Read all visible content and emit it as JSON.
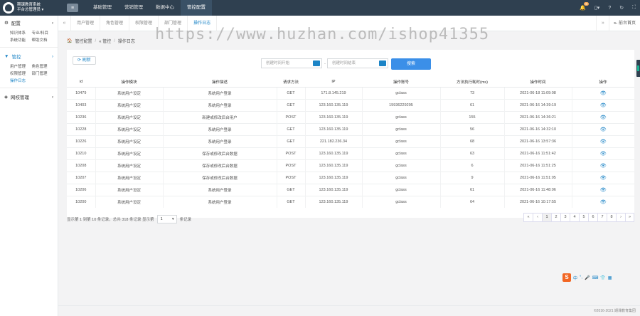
{
  "app": {
    "name_line1": "期课教育系统",
    "name_line2": "平台总管理员 ▾"
  },
  "topnav": [
    "基础管理",
    "营销管理",
    "数据中心",
    "管控配置"
  ],
  "topnav_active": 3,
  "notifications_count": "8",
  "sidebar": {
    "section1": {
      "label": "配置",
      "items": [
        "知识体系",
        "专业/科目",
        "系统功能",
        "帮助文档"
      ]
    },
    "section2": {
      "label": "管控",
      "items": [
        "用户管理",
        "角色管理",
        "权限管理",
        "部门管理",
        "操作日志"
      ],
      "active": 4
    },
    "section3": {
      "label": "网校管理"
    }
  },
  "tabs": [
    "用户管理",
    "角色管理",
    "权限管理",
    "部门管理",
    "操作日志"
  ],
  "tabs_active": 4,
  "back_label": "前台首页",
  "breadcrumb": [
    "管控配置",
    "管控",
    "操作日志"
  ],
  "toolbar": {
    "refresh_label": "刷新",
    "start_placeholder": "创建时间开始",
    "end_placeholder": "创建时间结束",
    "range_sep": "-",
    "search_label": "搜索"
  },
  "table": {
    "headers": [
      "id",
      "操作模块",
      "操作描述",
      "请求方法",
      "IP",
      "操作账号",
      "方法执行耗时(ms)",
      "操作时间",
      "操作"
    ],
    "rows": [
      [
        "10479",
        "系统用户设定",
        "系统用户登录",
        "GET",
        "171.8.145.219",
        "gclass",
        "73",
        "2021-06-18 11:09:08"
      ],
      [
        "10403",
        "系统用户设定",
        "系统用户登录",
        "GET",
        "123.160.135.119",
        "15936229295",
        "61",
        "2021-06-16 14:39:19"
      ],
      [
        "10236",
        "系统用户设定",
        "新建或修改后台用户",
        "POST",
        "123.160.135.119",
        "gclass",
        "155",
        "2021-06-16 14:36:21"
      ],
      [
        "10228",
        "系统用户设定",
        "系统用户登录",
        "GET",
        "123.160.135.119",
        "gclass",
        "56",
        "2021-06-16 14:32:10"
      ],
      [
        "10226",
        "系统用户设定",
        "系统用户登录",
        "GET",
        "221.182.236.34",
        "gclass",
        "68",
        "2021-06-16 13:57:36"
      ],
      [
        "10210",
        "系统用户设定",
        "保存或修改后台数据",
        "POST",
        "123.160.135.119",
        "gclass",
        "63",
        "2021-06-16 11:51:42"
      ],
      [
        "10208",
        "系统用户设定",
        "保存或修改后台数据",
        "POST",
        "123.160.135.119",
        "gclass",
        "6",
        "2021-06-16 11:51:25"
      ],
      [
        "10207",
        "系统用户设定",
        "保存或修改后台数据",
        "POST",
        "123.160.135.119",
        "gclass",
        "9",
        "2021-06-16 11:51:05"
      ],
      [
        "10206",
        "系统用户设定",
        "系统用户登录",
        "GET",
        "123.160.135.119",
        "gclass",
        "61",
        "2021-06-16 11:48:06"
      ],
      [
        "10200",
        "系统用户设定",
        "系统用户登录",
        "GET",
        "123.160.135.119",
        "gclass",
        "64",
        "2021-06-16 10:17:55"
      ]
    ]
  },
  "pager": {
    "info_prefix": "显示第 1 到第 10 条记录，总共 318 条记录 显示第",
    "page_size": "1",
    "info_suffix": "条记录",
    "pages": [
      "«",
      "‹",
      "1",
      "2",
      "3",
      "4",
      "5",
      "6",
      "7",
      "8",
      "›",
      "»"
    ],
    "active_page": "1"
  },
  "watermark": "https://www.huzhan.com/ishop41355",
  "ime": {
    "logo": "S",
    "lang": "中"
  },
  "footer": "©2016-2021 期课教育集团",
  "colors": {
    "topbar": "#2f4050",
    "accent": "#1c84c6",
    "search_button": "#3b8fe8"
  }
}
